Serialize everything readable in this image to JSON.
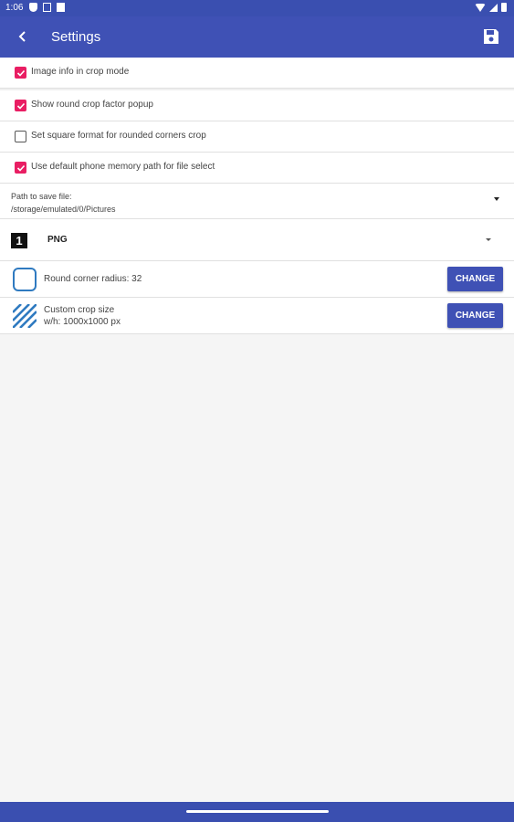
{
  "status_bar": {
    "time": "1:06",
    "icons": [
      "shield-icon",
      "notification-box-icon",
      "sd-card-icon",
      "wifi-icon",
      "signal-icon",
      "battery-icon"
    ]
  },
  "app_bar": {
    "title": "Settings",
    "back_icon": "arrow-back-icon",
    "save_icon": "floppy-save-icon",
    "color": "#3f51b5"
  },
  "settings": {
    "checkboxes": [
      {
        "label": "Image info in crop mode",
        "checked": true
      },
      {
        "label": "Show round crop factor popup",
        "checked": true
      },
      {
        "label": "Set square format for rounded corners crop",
        "checked": false
      },
      {
        "label": "Use default phone memory path for file select",
        "checked": true
      }
    ],
    "path": {
      "label": "Path to save file:",
      "value": "/storage/emulated/0/Pictures"
    },
    "format": {
      "icon_text": "1",
      "value": "PNG"
    },
    "round_corner": {
      "label": "Round corner radius: 32",
      "button": "CHANGE"
    },
    "custom_crop": {
      "label": "Custom crop size",
      "sub": "w/h: 1000x1000 px",
      "button": "CHANGE"
    }
  },
  "colors": {
    "accent": "#e91e63",
    "primary": "#3f51b5",
    "icon_blue": "#2f7ac0"
  }
}
